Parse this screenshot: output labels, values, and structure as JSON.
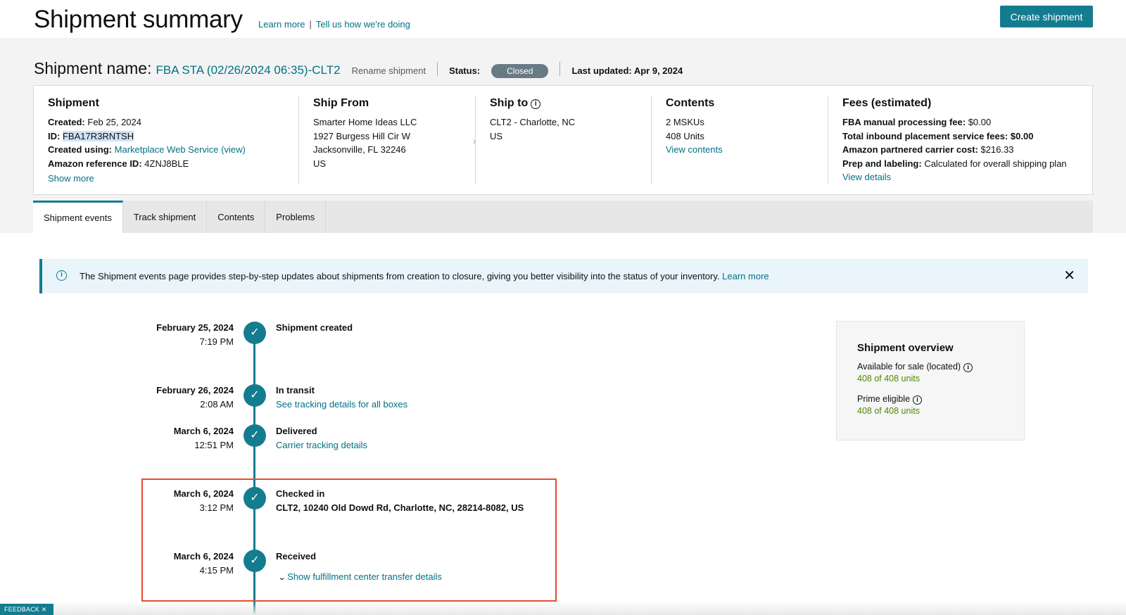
{
  "header": {
    "title": "Shipment summary",
    "learn_more": "Learn more",
    "separator": "|",
    "feedback_link": "Tell us how we're doing",
    "create_button": "Create shipment"
  },
  "shipment_name": {
    "label": "Shipment name:",
    "value": "FBA STA (02/26/2024 06:35)-CLT2",
    "rename": "Rename shipment",
    "status_label": "Status:",
    "status_value": "Closed",
    "last_updated": "Last updated: Apr 9, 2024"
  },
  "card": {
    "shipment": {
      "heading": "Shipment",
      "created_label": "Created:",
      "created_value": "Feb 25, 2024",
      "id_label": "ID:",
      "id_value": "FBA17R3RNTSH",
      "created_using_label": "Created using:",
      "created_using_value": "Marketplace Web Service (view)",
      "ref_label": "Amazon reference ID:",
      "ref_value": "4ZNJ8BLE",
      "show_more": "Show more"
    },
    "ship_from": {
      "heading": "Ship From",
      "lines": [
        "Smarter Home Ideas LLC",
        "1927 Burgess Hill Cir W",
        "Jacksonville, FL 32246",
        "US"
      ]
    },
    "ship_to": {
      "heading": "Ship to",
      "lines": [
        "CLT2 - Charlotte, NC",
        "US"
      ]
    },
    "contents": {
      "heading": "Contents",
      "mskus": "2 MSKUs",
      "units": "408 Units",
      "view_contents": "View contents"
    },
    "fees": {
      "heading": "Fees (estimated)",
      "manual_label": "FBA manual processing fee:",
      "manual_value": "$0.00",
      "placement_label": "Total inbound placement service fees:",
      "placement_value": "$0.00",
      "carrier_label": "Amazon partnered carrier cost:",
      "carrier_value": "$216.33",
      "prep_label": "Prep and labeling:",
      "prep_value": "Calculated for overall shipping plan",
      "view_details": "View details"
    }
  },
  "tabs": [
    "Shipment events",
    "Track shipment",
    "Contents",
    "Problems"
  ],
  "alert": {
    "text": "The Shipment events page provides step-by-step updates about shipments from creation to closure, giving you better visibility into the status of your inventory.",
    "link": "Learn more"
  },
  "events": [
    {
      "date": "February 25, 2024",
      "time": "7:19 PM",
      "title": "Shipment created",
      "sub": ""
    },
    {
      "date": "February 26, 2024",
      "time": "2:08 AM",
      "title": "In transit",
      "sub": "See tracking details for all boxes"
    },
    {
      "date": "March 6, 2024",
      "time": "12:51 PM",
      "title": "Delivered",
      "sub": "Carrier tracking details"
    },
    {
      "date": "March 6, 2024",
      "time": "3:12 PM",
      "title": "Checked in",
      "sub": "CLT2, 10240 Old Dowd Rd, Charlotte, NC, 28214-8082, US"
    },
    {
      "date": "March 6, 2024",
      "time": "4:15 PM",
      "title": "Received",
      "sub": "Show fulfillment center transfer details"
    }
  ],
  "overview": {
    "title": "Shipment overview",
    "available_label": "Available for sale (located)",
    "available_value": "408 of 408 units",
    "prime_label": "Prime eligible",
    "prime_value": "408 of 408 units"
  },
  "feedback_tab": "FEEDBACK ✕",
  "icons": {
    "info": "info-icon",
    "check": "check-icon",
    "close": "close-icon",
    "chevron": "chevron-down-icon"
  },
  "colors": {
    "accent": "#147c8f",
    "link": "#007185",
    "success": "#508a00",
    "highlight_box": "#e8492f"
  }
}
